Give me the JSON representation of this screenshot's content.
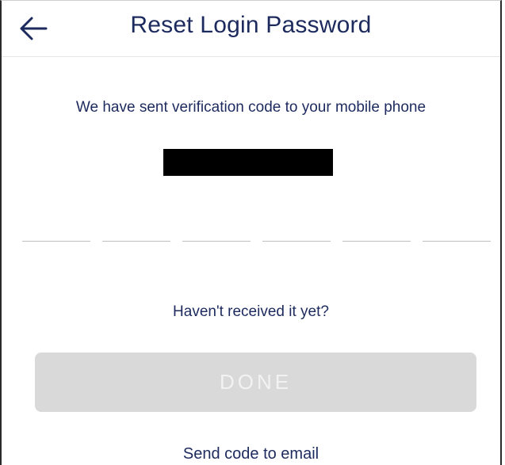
{
  "header": {
    "title": "Reset Login Password",
    "back_icon": "arrow-left-icon"
  },
  "main": {
    "info_text": "We have sent verification code to your mobile phone",
    "phone_number": "",
    "code_slots": 6,
    "not_received_text": "Haven't received it yet?",
    "done_label": "DONE",
    "send_email_label": "Send code to email"
  },
  "colors": {
    "primary_text": "#1c2a5e",
    "disabled_button_bg": "#d9d9d9",
    "disabled_button_text": "#f2f2f2",
    "slot_line": "#bfbfbf"
  }
}
